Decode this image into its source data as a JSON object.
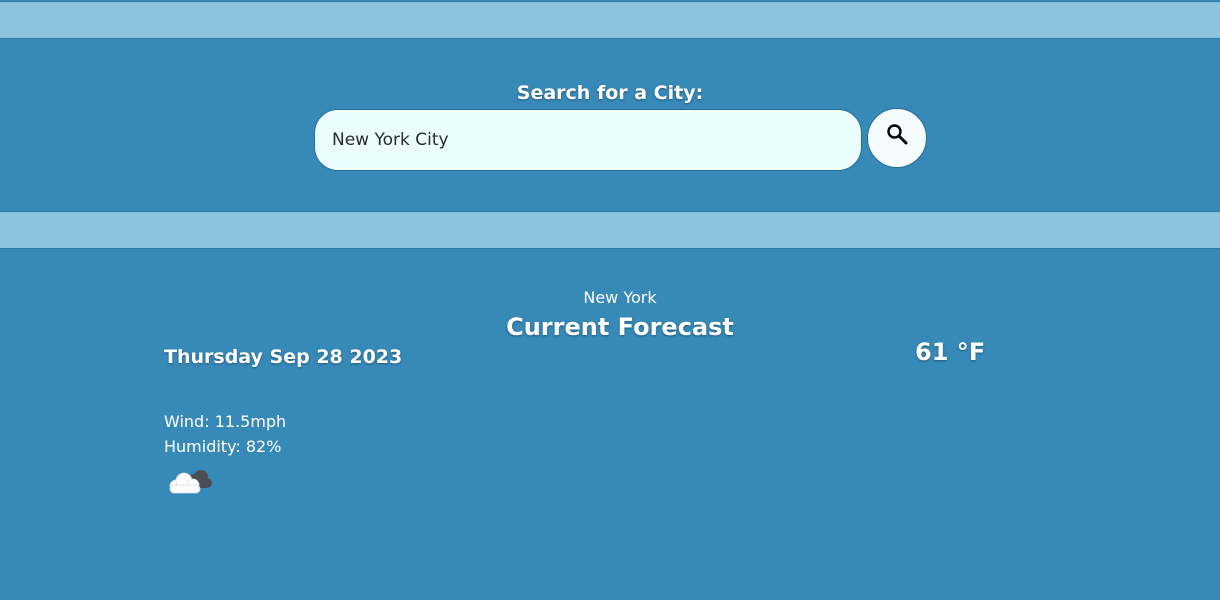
{
  "search": {
    "label": "Search for a City:",
    "value": "New York City",
    "button_icon": "search-icon"
  },
  "forecast": {
    "city": "New York",
    "heading": "Current Forecast",
    "date": "Thursday Sep 28 2023",
    "temperature": "61 °F",
    "wind": "Wind: 11.5mph",
    "humidity": "Humidity: 82%",
    "condition_icon": "cloud-icon"
  },
  "colors": {
    "background": "#3789b8",
    "band": "#8bc2de",
    "input_background": "#ebfdfc",
    "text": "#ffffff"
  }
}
